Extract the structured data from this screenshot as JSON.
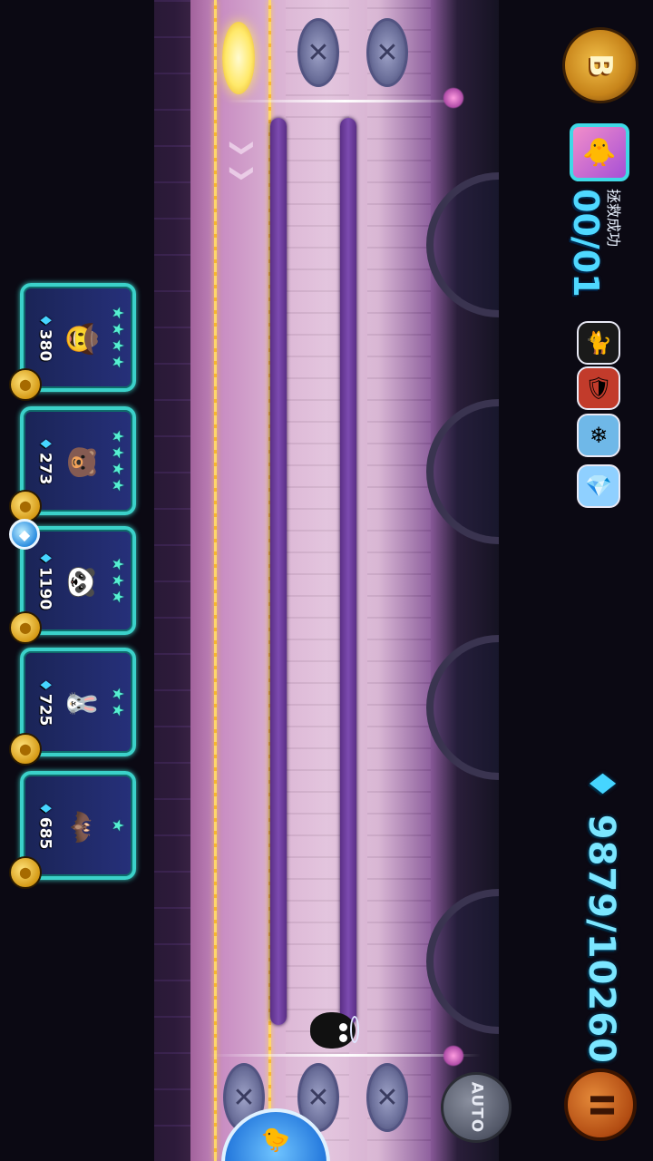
{
  "hud": {
    "rank_letter": "B",
    "rescue": {
      "icon": "duck-heart-icon",
      "count": "00/01",
      "label": "拯救成功"
    },
    "boosts": [
      {
        "name": "black-cat-boost-icon",
        "glyph": "🐈"
      },
      {
        "name": "shield-boost-icon",
        "glyph": "🛡"
      },
      {
        "name": "ice-crystal-boost-icon",
        "glyph": "❄"
      },
      {
        "name": "blue-crystal-boost-icon",
        "glyph": "💎"
      }
    ],
    "gems": "9879/10260",
    "pause_glyph": "II",
    "auto_label": "AUTO"
  },
  "cards": [
    {
      "cost": "380",
      "stars": 4,
      "portrait": "🤠"
    },
    {
      "cost": "273",
      "stars": 4,
      "portrait": "🐻"
    },
    {
      "cost": "1190",
      "stars": 3,
      "portrait": "🐼"
    },
    {
      "cost": "725",
      "stars": 2,
      "portrait": "🐰"
    },
    {
      "cost": "685",
      "stars": 1,
      "portrait": "🦇"
    }
  ],
  "colors": {
    "accent": "#3bd1c9",
    "gem": "#7be6ff",
    "rail": "#ffd76a"
  }
}
